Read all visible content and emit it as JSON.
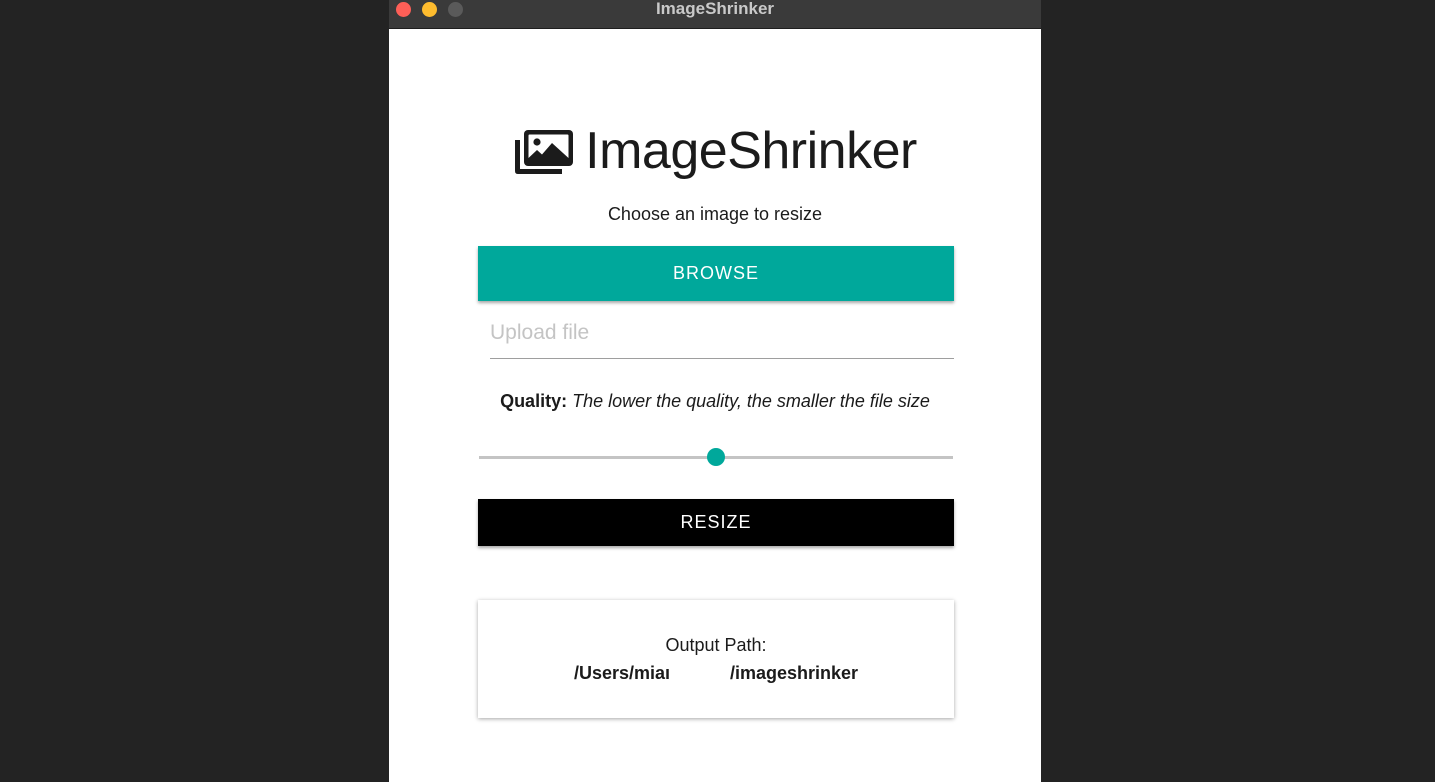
{
  "window": {
    "title": "ImageShrinker"
  },
  "header": {
    "app_name": "ImageShrinker",
    "subtitle": "Choose an image to resize"
  },
  "browse": {
    "label": "BROWSE"
  },
  "upload": {
    "placeholder": "Upload file",
    "value": ""
  },
  "quality": {
    "label": "Quality:",
    "hint": "The lower the quality, the smaller the file size",
    "slider_value_fraction": 0.5
  },
  "resize": {
    "label": "RESIZE"
  },
  "output": {
    "label": "Output Path:",
    "path": "/Users/miaı            /imageshrinker"
  },
  "colors": {
    "accent": "#00a89b",
    "resize_button": "#000000",
    "titlebar": "#3a3a3a",
    "traffic_close": "#fe5f57",
    "traffic_minimize": "#febc2e",
    "traffic_zoom": "#5a5a5a"
  },
  "icons": {
    "brand": "images-icon"
  }
}
